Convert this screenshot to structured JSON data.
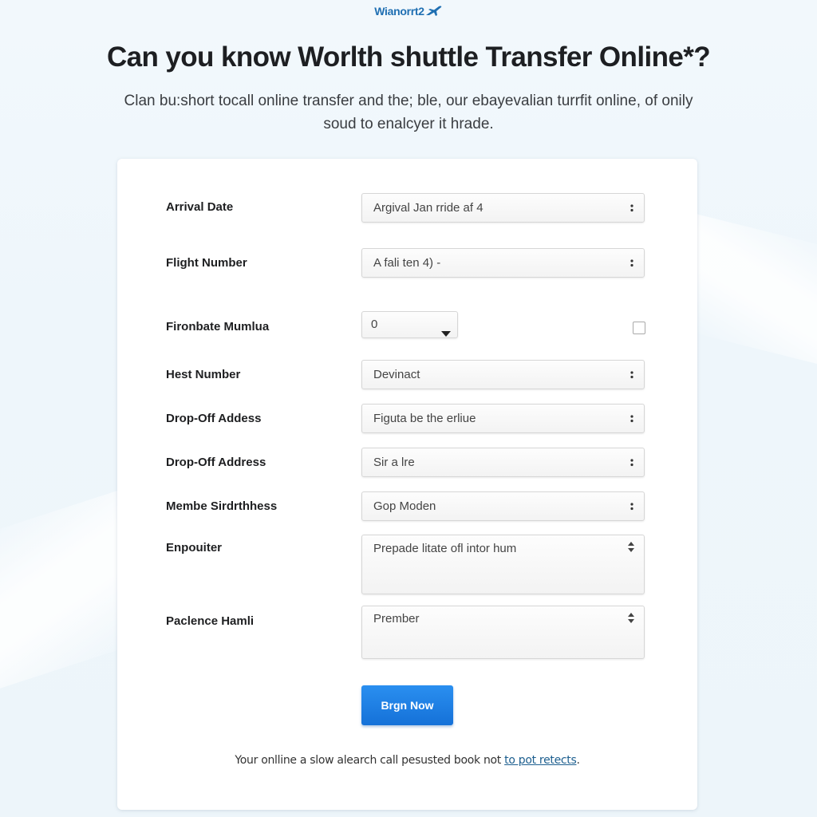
{
  "brand": {
    "logo_text": "Wianorrt2",
    "logo_icon": "airplane-icon",
    "accent_color": "#1f6fb2"
  },
  "header": {
    "title": "Can you know Worlth shuttle Transfer Online*?",
    "subtitle": "Clan bu:short tocall online transfer and the; ble, our ebayevalian turrfit online, of onily soud to enalcyer it hrade."
  },
  "form": {
    "rows": [
      {
        "label": "Arrival Date",
        "value": "Argival Jan rride af 4",
        "control": "select",
        "icon": "spinner-icon"
      },
      {
        "label": "Flight Number",
        "value": "A fali ten 4) -",
        "control": "select",
        "icon": "spinner-icon"
      },
      {
        "label": "Fironbate Mumlua",
        "value": "0",
        "control": "dropdown",
        "icon": "caret-down-icon",
        "checkbox_checked": false
      },
      {
        "label": "Hest Number",
        "value": "Devinact",
        "control": "select",
        "icon": "spinner-icon"
      },
      {
        "label": "Drop-Off Addess",
        "value": "Figuta be the erliue",
        "control": "select",
        "icon": "spinner-icon"
      },
      {
        "label": "Drop-Off Address",
        "value": "Sir a lre",
        "control": "select",
        "icon": "spinner-icon"
      },
      {
        "label": "Membe Sirdrthhess",
        "value": "Gop Moden",
        "control": "select",
        "icon": "spinner-icon"
      },
      {
        "label": "Enpouiter",
        "value": "Prepade litate ofl intor hum",
        "control": "textarea-select",
        "icon": "sort-arrows-icon"
      },
      {
        "label": "Paclence Hamli",
        "value": "Prember",
        "control": "textarea-select",
        "icon": "sort-arrows-icon"
      }
    ],
    "submit_label": "Brgn Now",
    "submit_color": "#1a7fe6"
  },
  "footer": {
    "note_text": "Your onlline a slow alearch call pesusted book not ",
    "note_link": "to pot retects",
    "note_end": ".",
    "link_color": "#1d5f8f"
  }
}
